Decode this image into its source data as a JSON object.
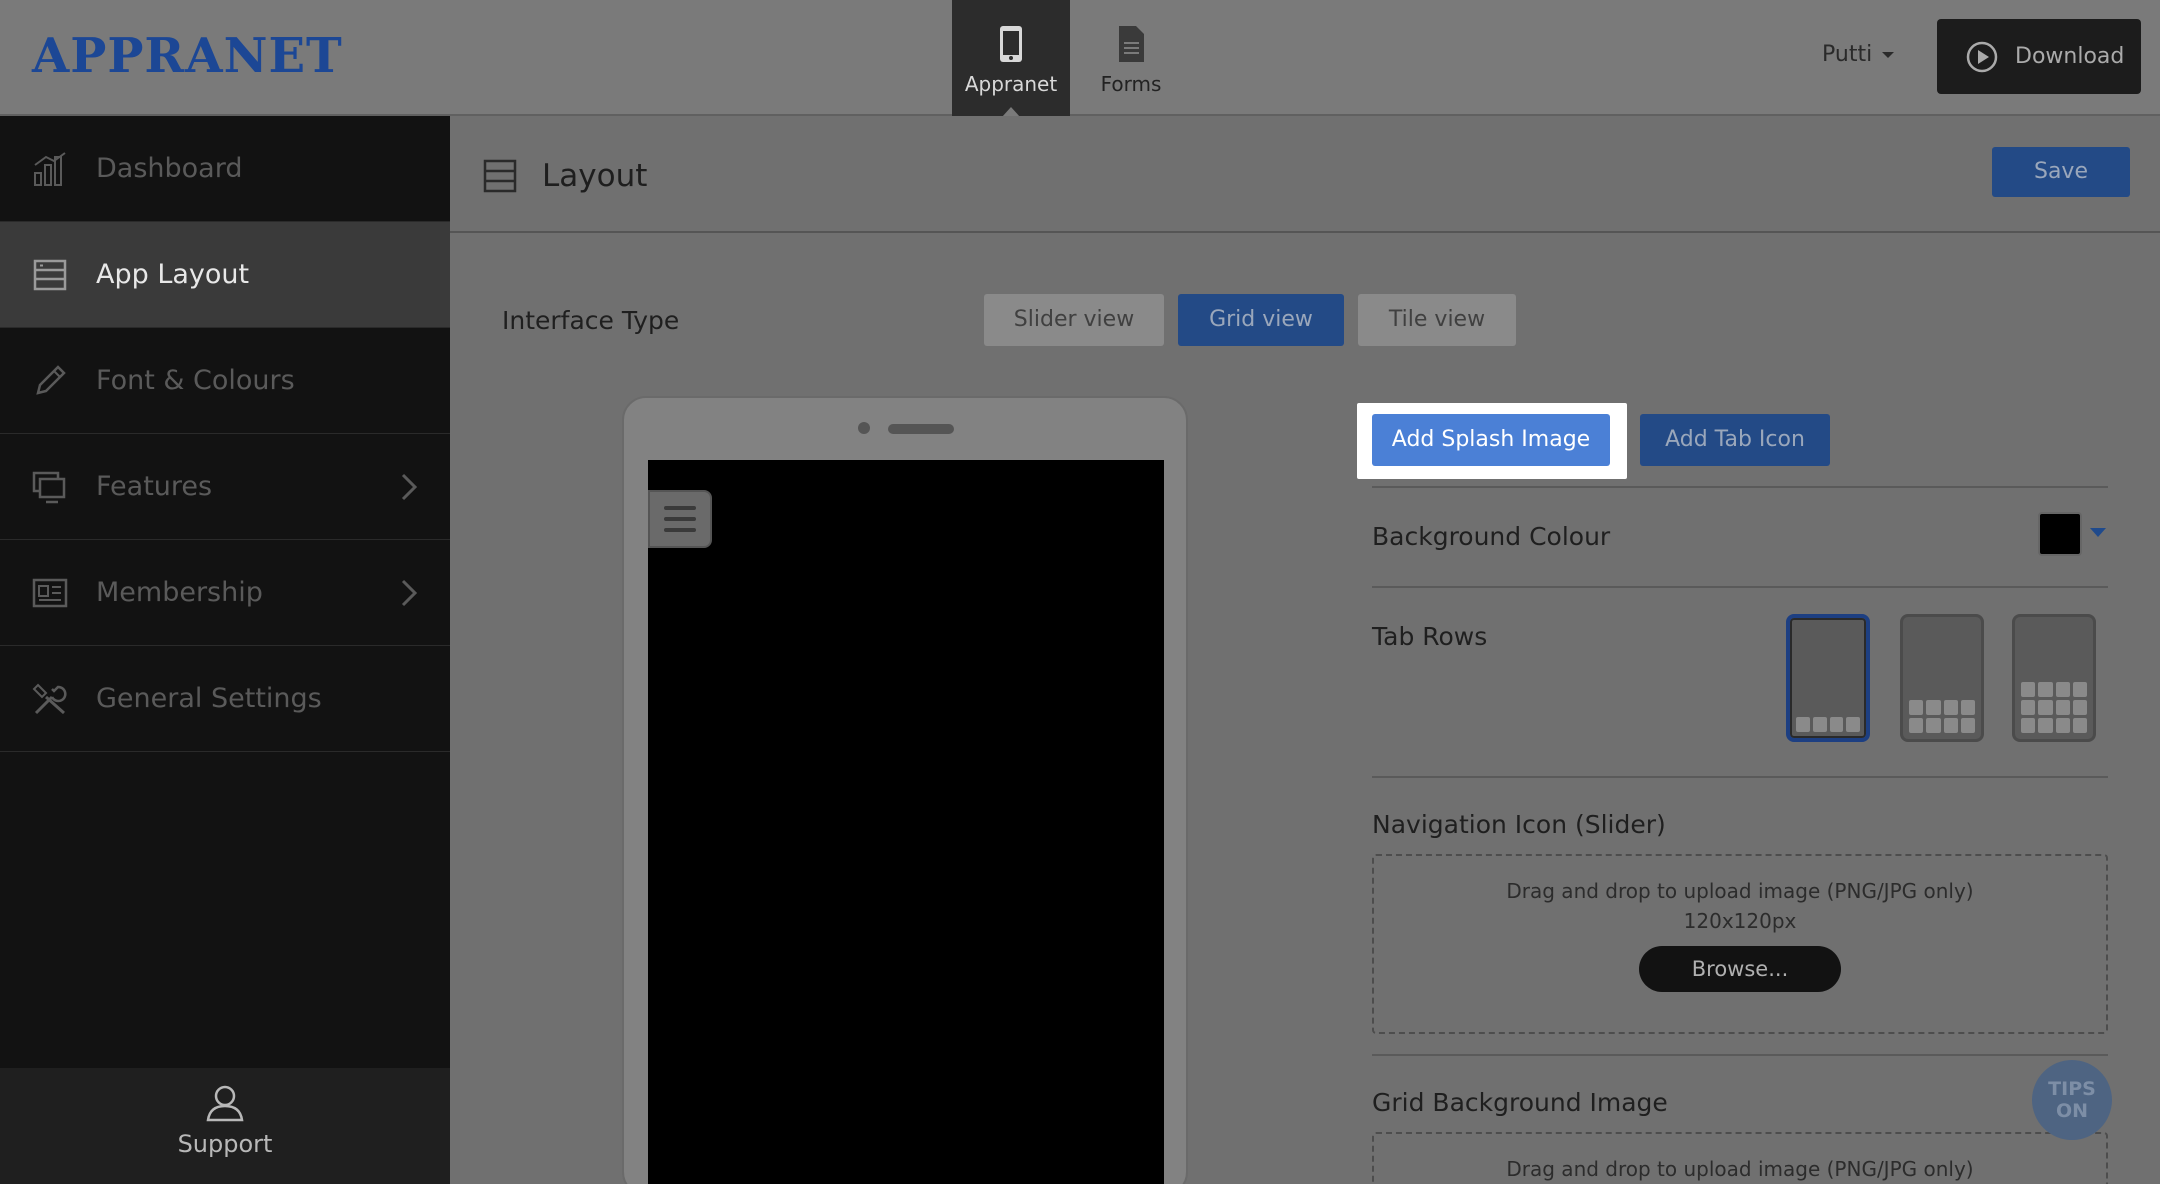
{
  "header": {
    "logo": "APPRANET",
    "nav": [
      {
        "label": "Appranet",
        "icon": "phone-icon",
        "active": true
      },
      {
        "label": "Forms",
        "icon": "document-icon",
        "active": false
      }
    ],
    "user": "Putti",
    "download_label": "Download"
  },
  "sidebar": {
    "items": [
      {
        "label": "Dashboard",
        "icon": "bar-chart-icon"
      },
      {
        "label": "App Layout",
        "icon": "layout-icon",
        "active": true
      },
      {
        "label": "Font & Colours",
        "icon": "pencil-icon"
      },
      {
        "label": "Features",
        "icon": "screens-icon",
        "has_submenu": true
      },
      {
        "label": "Membership",
        "icon": "id-card-icon",
        "has_submenu": true
      },
      {
        "label": "General Settings",
        "icon": "tools-icon"
      }
    ],
    "support_label": "Support"
  },
  "main": {
    "title": "Layout",
    "save_label": "Save",
    "interface_type": {
      "label": "Interface Type",
      "options": [
        "Slider view",
        "Grid view",
        "Tile view"
      ],
      "selected": "Grid view"
    },
    "splash_button": "Add Splash Image",
    "tab_icon_button": "Add Tab Icon",
    "background_colour": {
      "label": "Background Colour",
      "value": "#000000"
    },
    "tab_rows": {
      "label": "Tab Rows",
      "options": [
        1,
        2,
        3
      ],
      "selected": 1
    },
    "navigation_icon": {
      "label": "Navigation Icon (Slider)",
      "hint": "Drag and drop to upload image (PNG/JPG only)",
      "size": "120x120px",
      "browse_label": "Browse..."
    },
    "grid_background": {
      "label": "Grid Background Image",
      "hint": "Drag and drop to upload image (PNG/JPG only)"
    },
    "tips_badge": {
      "line1": "TIPS",
      "line2": "ON"
    }
  },
  "colors": {
    "brand": "#1c4795",
    "primary_button": "#234a86",
    "highlight_button": "#4b80d6",
    "sidebar_bg": "#121212"
  }
}
